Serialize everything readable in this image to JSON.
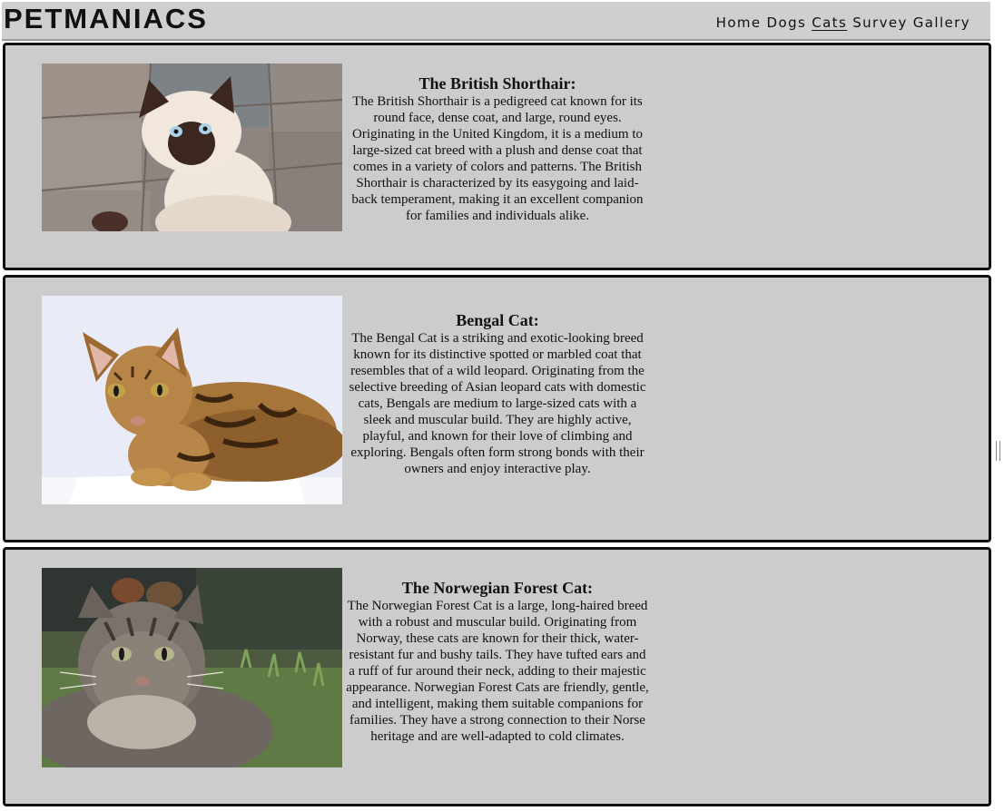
{
  "header": {
    "logo": "PETMANIACS",
    "nav": [
      "Home",
      "Dogs",
      "Cats",
      "Survey",
      "Gallery"
    ],
    "active_nav": "Cats"
  },
  "cats": [
    {
      "title": "The British Shorthair:",
      "description": "The British Shorthair is a pedigreed cat known for its round face, dense coat, and large, round eyes. Originating in the United Kingdom, it is a medium to large-sized cat breed with a plush and dense coat that comes in a variety of colors and patterns. The British Shorthair is characterized by its easygoing and laid-back temperament, making it an excellent companion for families and individuals alike."
    },
    {
      "title": "Bengal Cat:",
      "description": "The Bengal Cat is a striking and exotic-looking breed known for its distinctive spotted or marbled coat that resembles that of a wild leopard. Originating from the selective breeding of Asian leopard cats with domestic cats, Bengals are medium to large-sized cats with a sleek and muscular build. They are highly active, playful, and known for their love of climbing and exploring. Bengals often form strong bonds with their owners and enjoy interactive play."
    },
    {
      "title": "The Norwegian Forest Cat:",
      "description": "The Norwegian Forest Cat is a large, long-haired breed with a robust and muscular build. Originating from Norway, these cats are known for their thick, water-resistant fur and bushy tails. They have tufted ears and a ruff of fur around their neck, adding to their majestic appearance. Norwegian Forest Cats are friendly, gentle, and intelligent, making them suitable companions for families. They have a strong connection to their Norse heritage and are well-adapted to cold climates."
    }
  ]
}
